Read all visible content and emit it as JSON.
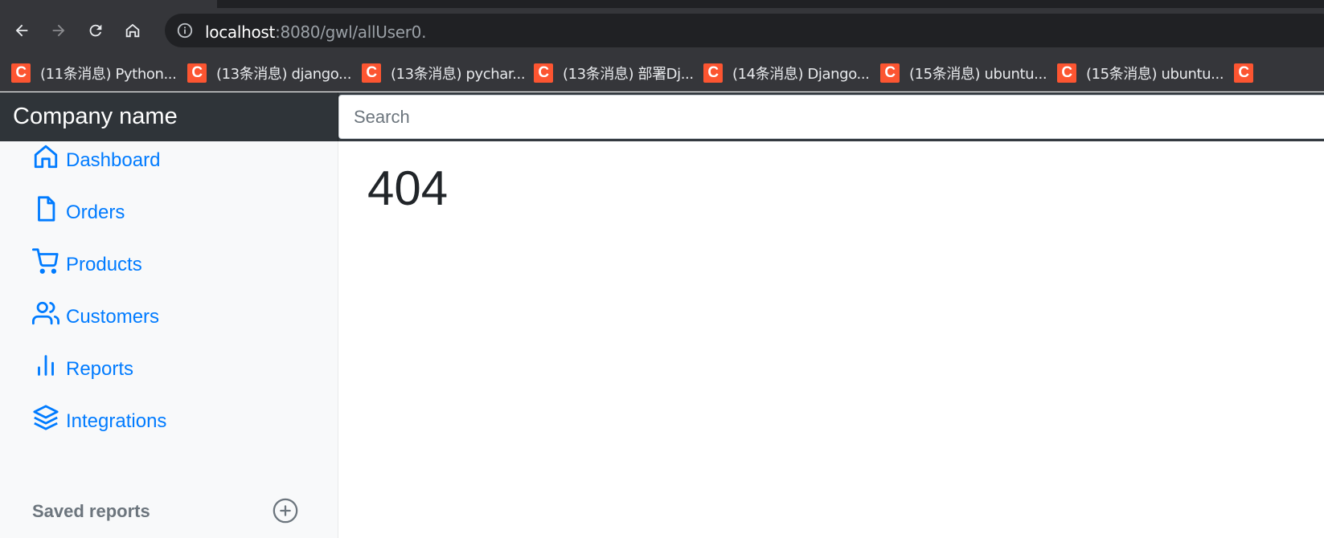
{
  "browser": {
    "url_host": "localhost",
    "url_path": ":8080/gwl/allUser0.",
    "bookmarks": [
      {
        "icon": "csdn-c-icon",
        "icon_text": "C",
        "label": "(11条消息) Python..."
      },
      {
        "icon": "csdn-c-icon",
        "icon_text": "C",
        "label": "(13条消息) django..."
      },
      {
        "icon": "csdn-c-icon",
        "icon_text": "C",
        "label": "(13条消息) pychar..."
      },
      {
        "icon": "csdn-c-icon",
        "icon_text": "C",
        "label": "(13条消息) 部署Dj..."
      },
      {
        "icon": "csdn-c-icon",
        "icon_text": "C",
        "label": "(14条消息) Django..."
      },
      {
        "icon": "csdn-c-icon",
        "icon_text": "C",
        "label": "(15条消息) ubuntu..."
      },
      {
        "icon": "csdn-c-icon",
        "icon_text": "C",
        "label": "(15条消息) ubuntu..."
      },
      {
        "icon": "csdn-c-icon",
        "icon_text": "C",
        "label": ""
      }
    ]
  },
  "navbar": {
    "brand": "Company name",
    "search_placeholder": "Search"
  },
  "sidebar": {
    "items": [
      {
        "icon": "home-icon",
        "label": "Dashboard"
      },
      {
        "icon": "file-icon",
        "label": "Orders"
      },
      {
        "icon": "shopping-cart-icon",
        "label": "Products"
      },
      {
        "icon": "users-icon",
        "label": "Customers"
      },
      {
        "icon": "bar-chart-icon",
        "label": "Reports"
      },
      {
        "icon": "layers-icon",
        "label": "Integrations"
      }
    ],
    "saved_reports_heading": "Saved reports"
  },
  "main": {
    "title": "404"
  },
  "colors": {
    "link": "#007bff",
    "navbar": "#343a40",
    "sidebar_bg": "#f8f9fa",
    "favicon": "#fc5531"
  }
}
